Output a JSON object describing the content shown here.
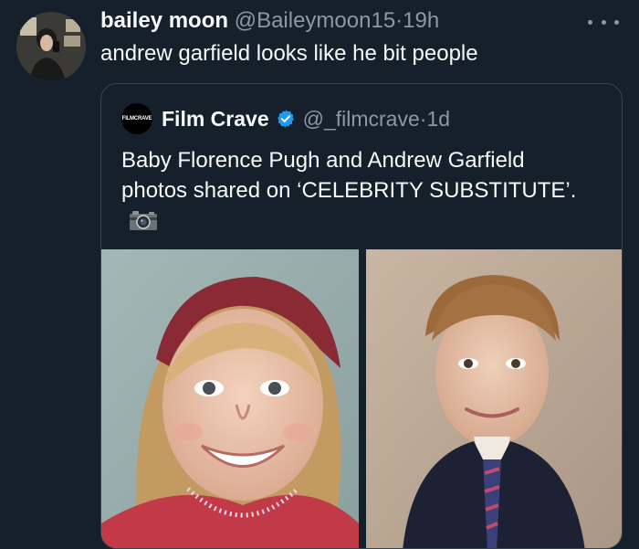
{
  "tweet": {
    "display_name": "bailey moon",
    "handle": "@Baileymoon15",
    "dot": "·",
    "time": "19h",
    "text": "andrew garfield looks like he bit people"
  },
  "quoted": {
    "avatar_text": "FILMCRAVE",
    "display_name": "Film Crave",
    "handle": "@_filmcrave",
    "dot": "·",
    "time": "1d",
    "text": "Baby Florence Pugh and Andrew Garfield photos shared on ‘CELEBRITY SUBSTITUTE’."
  },
  "icons": {
    "more": "more-horizontal-icon",
    "verified": "verified-badge-icon",
    "camera": "camera-emoji-icon"
  },
  "colors": {
    "background": "#15202b",
    "text_primary": "#f7f9f9",
    "text_secondary": "#8b98a5",
    "border": "#38444d",
    "verified": "#1d9bf0"
  }
}
